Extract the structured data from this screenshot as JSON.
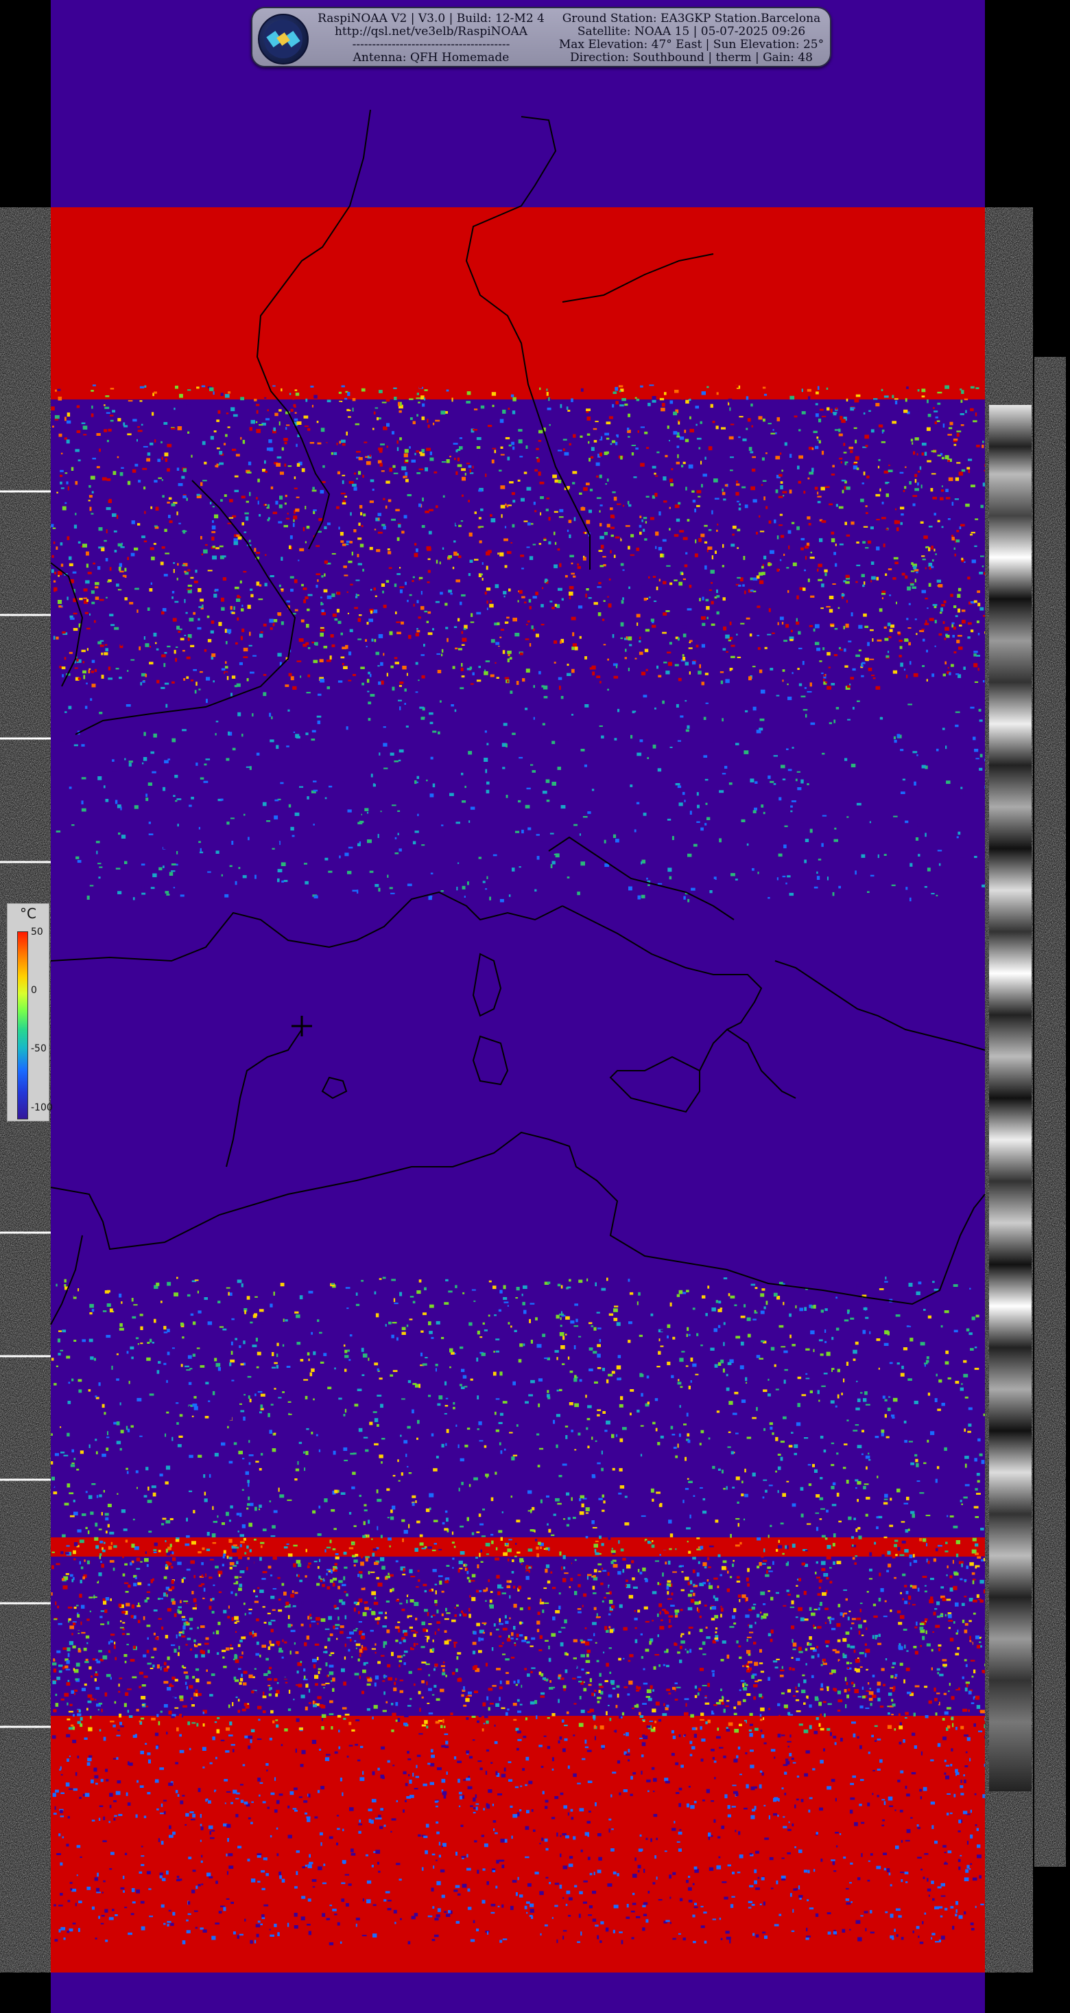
{
  "header": {
    "line1_left": "RaspiNOAA V2 | V3.0 | Build: 12-M2 4",
    "line2_left": "http://qsl.net/ve3elb/RaspiNOAA",
    "line3_left": "----------------------------------------",
    "line4_left": "Antenna: QFH Homemade",
    "line1_right": "Ground Station: EA3GKP Station.Barcelona",
    "line2_right": "Satellite: NOAA 15 | 05-07-2025 09:26",
    "line3_right": "Max Elevation: 47° East | Sun Elevation: 25°",
    "line4_right": "Direction: Southbound | therm | Gain: 48"
  },
  "legend": {
    "unit": "°C",
    "ticks": [
      {
        "label": "50",
        "value": 50
      },
      {
        "label": "0",
        "value": 0
      },
      {
        "label": "-50",
        "value": -50
      },
      {
        "label": "-100",
        "value": -100
      }
    ]
  },
  "colors": {
    "background_sea": "#3c0095",
    "cloud_hot": "#d00000",
    "coastline": "#000000",
    "side_strip": "#000000"
  },
  "icons": {
    "logo": "satellite-globe-icon",
    "station_marker": "crosshair-marker-icon"
  }
}
